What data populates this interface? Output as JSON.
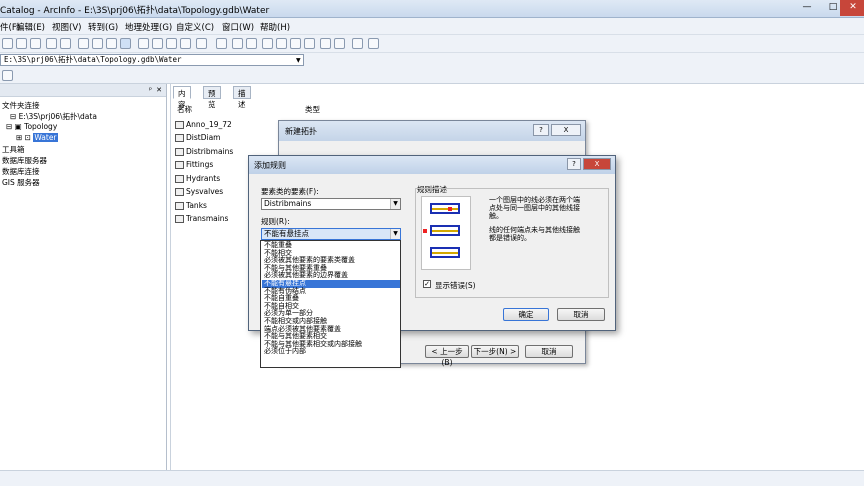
{
  "window": {
    "title": "Catalog - ArcInfo - E:\\3S\\prj06\\拓扑\\data\\Topology.gdb\\Water"
  },
  "menu": [
    "件(F)",
    "编辑(E)",
    "视图(V)",
    "转到(G)",
    "地理处理(G)",
    "自定义(C)",
    "窗口(W)",
    "帮助(H)"
  ],
  "address": {
    "value": "E:\\3S\\prj06\\拓扑\\data\\Topology.gdb\\Water"
  },
  "tree": {
    "nodes": [
      "文件夹连接",
      "E:\\3S\\prj06\\拓扑\\data",
      "Topology",
      "Water",
      "工具箱",
      "数据库服务器",
      "数据库连接",
      "GIS 服务器"
    ]
  },
  "content": {
    "tabs": [
      "内容",
      "预览",
      "描述"
    ],
    "columns": [
      "名称",
      "类型"
    ],
    "items": [
      "Anno_19_72",
      "DistDiam",
      "Distribmains",
      "Fittings",
      "Hydrants",
      "Sysvalves",
      "Tanks",
      "Transmains"
    ]
  },
  "back_dialog": {
    "title": "新建拓扑",
    "help": "?",
    "close": "X",
    "back": "< 上一步(B)",
    "next": "下一步(N) >",
    "cancel": "取消"
  },
  "dialog": {
    "title": "添加规则",
    "close": "X",
    "feature_label": "要素类的要素(F):",
    "feature_value": "Distribmains",
    "rule_label": "规则(R):",
    "rule_value": "不能有悬挂点",
    "desc_title": "规则描述",
    "desc_lines": [
      "一个图层中的线必须在两个端",
      "点处与同一图层中的其他线接",
      "触。"
    ],
    "desc_lines2": [
      "线的任何端点未与其他线接触",
      "都是错误的。"
    ],
    "show_errors": "显示错误(S)",
    "ok": "确定",
    "cancel": "取消"
  },
  "rule_options": [
    "不能重叠",
    "不能相交",
    "必须被其他要素的要素类覆盖",
    "不能与其他要素重叠",
    "必须被其他要素的边界覆盖",
    "不能有悬挂点",
    "不能有伪结点",
    "不能自重叠",
    "不能自相交",
    "必须为单一部分",
    "不能相交或内部接触",
    "端点必须被其他要素覆盖",
    "不能与其他要素相交",
    "不能与其他要素相交或内部接触",
    "必须位于内部"
  ],
  "colors": {
    "selection": "#3875d7"
  }
}
